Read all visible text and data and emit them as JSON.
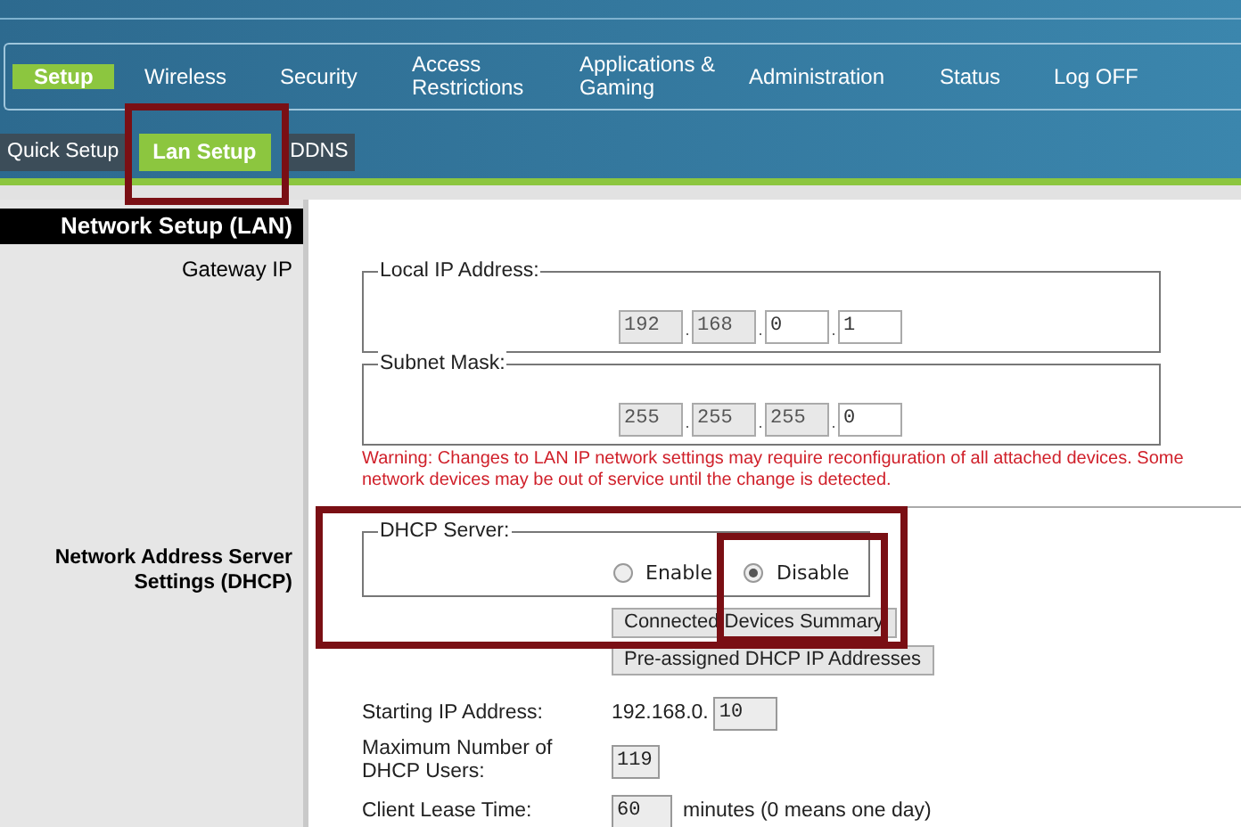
{
  "main_menu": [
    {
      "label": "Setup",
      "selected": true
    },
    {
      "label": "Wireless",
      "selected": false
    },
    {
      "label": "Security",
      "selected": false
    },
    {
      "label": "Access Restrictions",
      "selected": false
    },
    {
      "label": "Applications & Gaming",
      "selected": false
    },
    {
      "label": "Administration",
      "selected": false
    },
    {
      "label": "Status",
      "selected": false
    },
    {
      "label": "Log OFF",
      "selected": false
    }
  ],
  "sub_tabs": [
    {
      "label": "Quick Setup",
      "selected": false
    },
    {
      "label": "Lan Setup",
      "selected": true
    },
    {
      "label": "DDNS",
      "selected": false
    }
  ],
  "sidebar": {
    "title": "Network Setup (LAN)",
    "sections": [
      "Gateway IP",
      "Network Address Server Settings (DHCP)"
    ]
  },
  "local_ip": {
    "legend": "Local IP Address:",
    "octets": [
      {
        "value": "192",
        "disabled": true
      },
      {
        "value": "168",
        "disabled": true
      },
      {
        "value": "0",
        "disabled": false
      },
      {
        "value": "1",
        "disabled": false
      }
    ]
  },
  "subnet_mask": {
    "legend": "Subnet Mask:",
    "octets": [
      {
        "value": "255",
        "disabled": true
      },
      {
        "value": "255",
        "disabled": true
      },
      {
        "value": "255",
        "disabled": true
      },
      {
        "value": "0",
        "disabled": false
      }
    ]
  },
  "warning": "Warning: Changes to LAN IP network settings may require reconfiguration of all attached devices. Some network devices may be out of service until the change is detected.",
  "dhcp_server": {
    "legend": "DHCP Server:",
    "options": [
      {
        "label": "Enable",
        "selected": false
      },
      {
        "label": "Disable",
        "selected": true
      }
    ]
  },
  "buttons": [
    "Connected Devices Summary",
    "Pre-assigned DHCP IP Addresses"
  ],
  "starting_ip": {
    "label": "Starting IP Address:",
    "prefix": "192.168.0.",
    "value": "10"
  },
  "max_users": {
    "label": "Maximum Number of DHCP Users:",
    "value": "119"
  },
  "lease_time": {
    "label": "Client Lease Time:",
    "value": "60",
    "unit": "minutes (0 means one day)"
  }
}
